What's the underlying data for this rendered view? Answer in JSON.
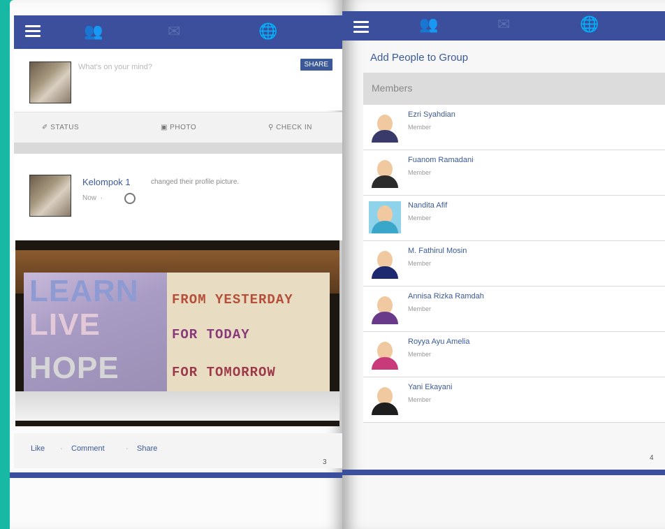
{
  "left_page": {
    "composer": {
      "placeholder": "What's on your mind?",
      "share_label": "SHARE"
    },
    "actions": {
      "status": "✐ STATUS",
      "photo": "▣ PHOTO",
      "check_in": "⚲ CHECK IN"
    },
    "post": {
      "author": "Kelompok 1",
      "action": "changed their profile picture.",
      "time": "Now",
      "time_sep": "·",
      "photo": {
        "line1": "LEARN",
        "line2": "LIVE",
        "line3": "HOPE",
        "phrase1": "FROM YESTERDAY",
        "phrase2": "FOR TODAY",
        "phrase3": "FOR TOMORROW"
      },
      "footer": {
        "like": "Like",
        "comment": "Comment",
        "share": "Share",
        "sep": "·"
      }
    },
    "page_number": "3"
  },
  "right_page": {
    "title": "Add People to Group",
    "members_label": "Members",
    "members": [
      {
        "name": "Ezri Syahdian",
        "role": "Member",
        "body_color": "#3a3a6a",
        "bg": "#ffffff"
      },
      {
        "name": "Fuanom Ramadani",
        "role": "Member",
        "body_color": "#2b2b2b",
        "bg": "#ffffff"
      },
      {
        "name": "Nandita Afif",
        "role": "Member",
        "body_color": "#3aa6c9",
        "bg": "#8fd3ea"
      },
      {
        "name": "M. Fathirul Mosin",
        "role": "Member",
        "body_color": "#1e2a70",
        "bg": "#ffffff"
      },
      {
        "name": "Annisa Rizka Ramdah",
        "role": "Member",
        "body_color": "#6a3a8a",
        "bg": "#ffffff"
      },
      {
        "name": "Royya Ayu Amelia",
        "role": "Member",
        "body_color": "#c83a7a",
        "bg": "#ffffff"
      },
      {
        "name": "Yani Ekayani",
        "role": "Member",
        "body_color": "#1e1e1e",
        "bg": "#ffffff"
      }
    ],
    "page_number": "4"
  },
  "icons": {
    "menu": "menu-icon",
    "friends": "friends-icon",
    "messages": "messages-icon",
    "globe": "globe-icon"
  }
}
